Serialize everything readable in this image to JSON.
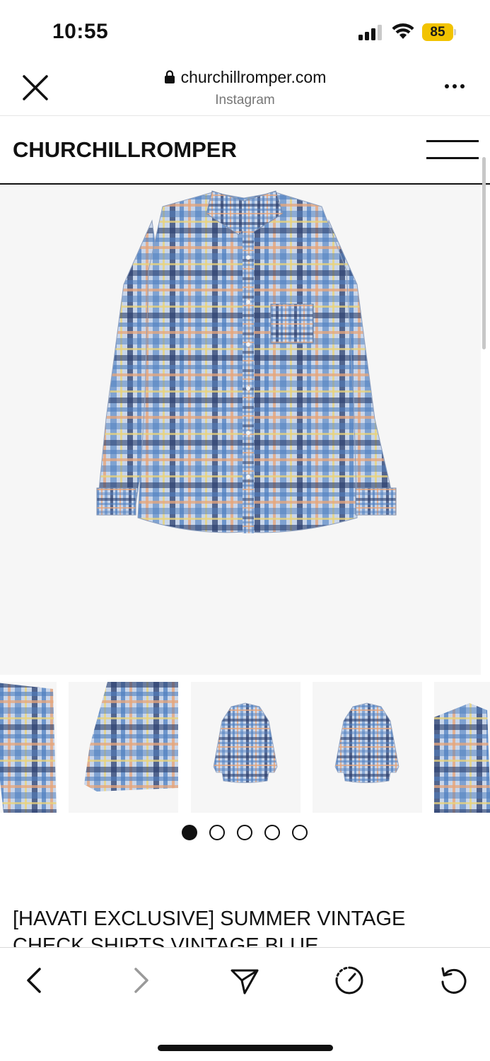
{
  "status_bar": {
    "time": "10:55",
    "battery_level": "85",
    "icons": [
      "signal-icon",
      "wifi-icon",
      "battery-icon"
    ]
  },
  "browser": {
    "url": "churchillromper.com",
    "subtitle": "Instagram",
    "icons": [
      "close-icon",
      "lock-icon",
      "more-icon"
    ]
  },
  "site": {
    "brand": "CHURCHILLROMPER",
    "icons": [
      "hamburger-menu-icon"
    ]
  },
  "product": {
    "title": "[HAVATI EXCLUSIVE] SUMMER VINTAGE CHECK SHIRTS VINTAGE BLUE",
    "image_count": 5,
    "active_image": 1
  },
  "toolbar": {
    "icons": [
      "back-arrow-icon",
      "forward-arrow-icon",
      "share-icon",
      "speed-dial-icon",
      "refresh-icon"
    ]
  },
  "colors": {
    "battery": "#f2c300",
    "image_background": "#f6f6f6",
    "plaid_blue": "#4f7fc0",
    "plaid_navy": "#2b3f6e",
    "plaid_orange": "#e7a57b"
  }
}
